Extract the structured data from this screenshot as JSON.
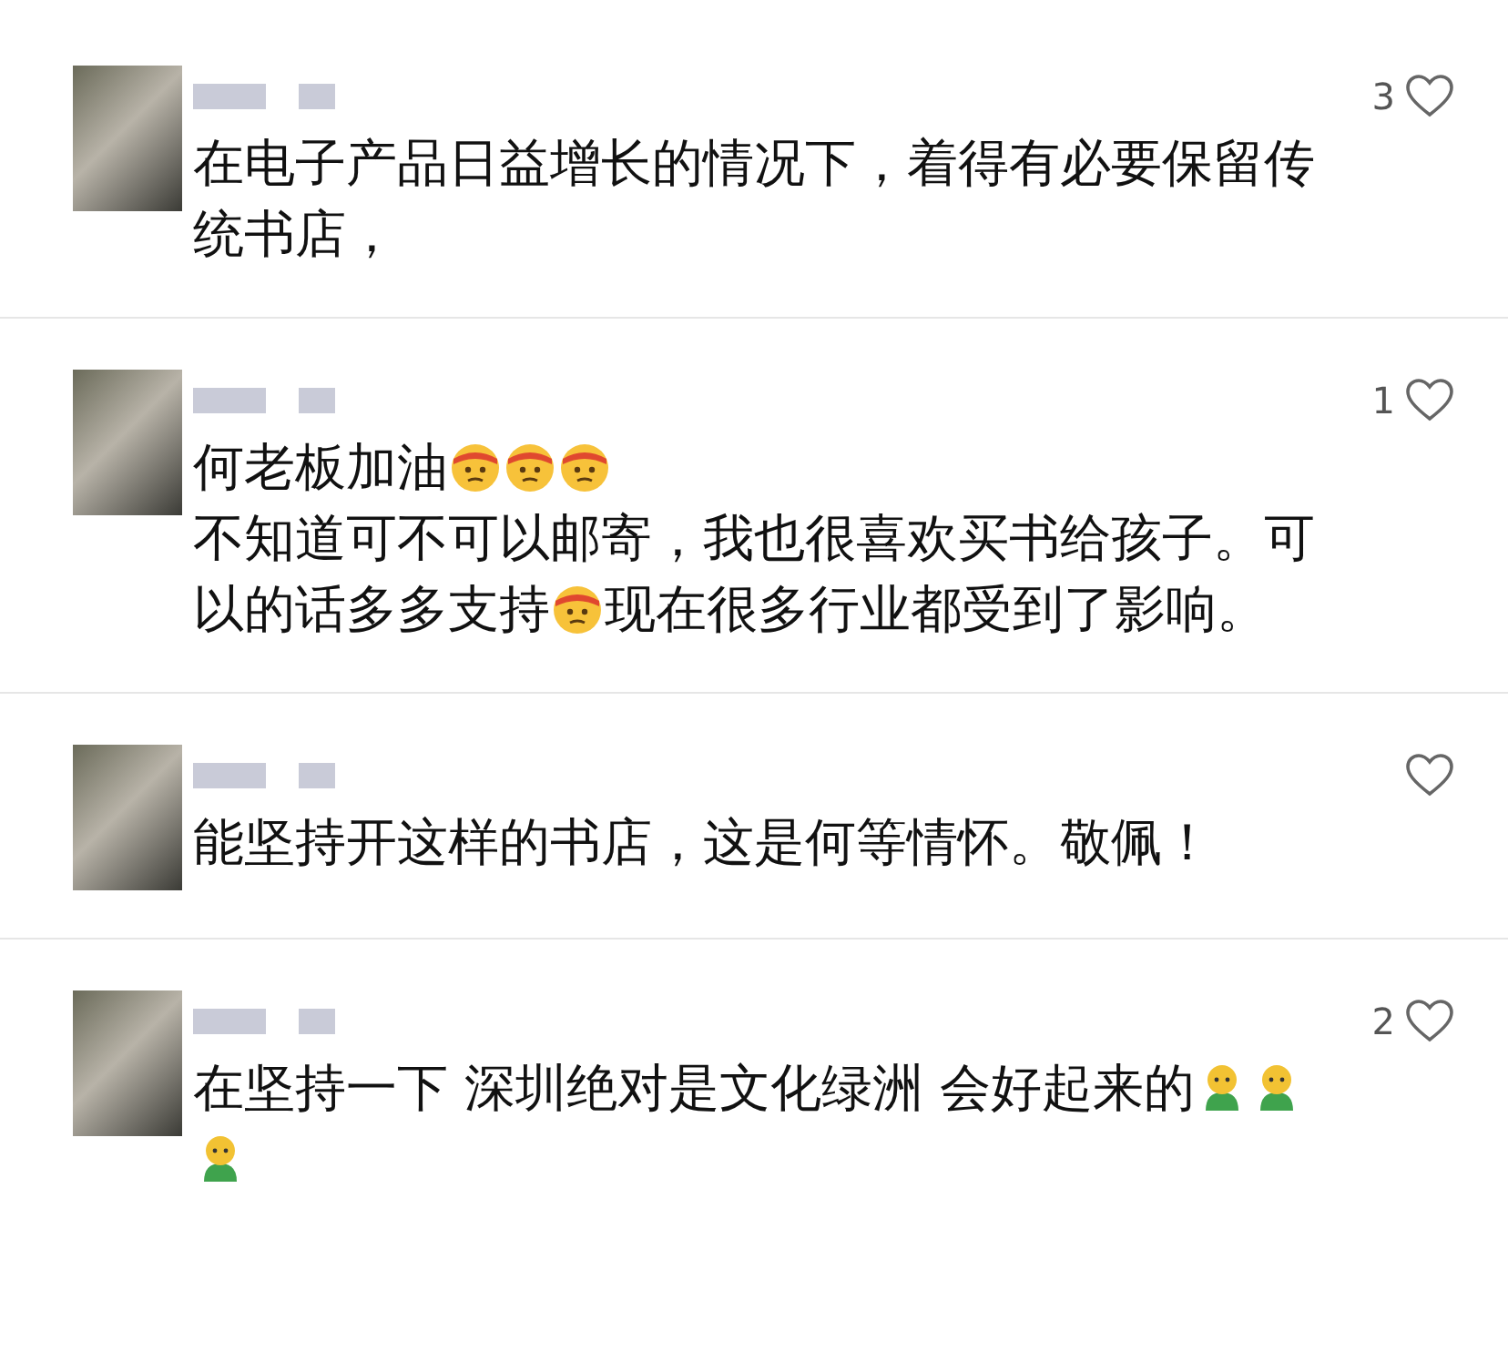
{
  "comments": [
    {
      "likes": "3",
      "liked": false,
      "paragraphs": [
        [
          {
            "kind": "text",
            "text": "在电子产品日益增长的情况下，着得有必要保留传"
          }
        ],
        [
          {
            "kind": "text",
            "text": "统书店，"
          }
        ]
      ]
    },
    {
      "likes": "1",
      "liked": false,
      "paragraphs": [
        [
          {
            "kind": "text",
            "text": "何老板加油"
          },
          {
            "kind": "emoji"
          },
          {
            "kind": "emoji"
          },
          {
            "kind": "emoji"
          }
        ],
        [
          {
            "kind": "text",
            "text": "不知道可不可以邮寄，我也很喜欢买书给孩子。可"
          }
        ],
        [
          {
            "kind": "text",
            "text": "以的话多多支持"
          },
          {
            "kind": "emoji"
          },
          {
            "kind": "text",
            "text": "现在很多行业都受到了影响。"
          }
        ]
      ]
    },
    {
      "liked": false,
      "paragraphs": [
        [
          {
            "kind": "text",
            "text": "能坚持开这样的书店，这是何等情怀。敬佩！"
          }
        ]
      ]
    },
    {
      "likes": "2",
      "liked": false,
      "paragraphs": [
        [
          {
            "kind": "text",
            "text": "在坚持一下 深圳绝对是文化绿洲 会好起来的"
          },
          {
            "kind": "person"
          },
          {
            "kind": "person"
          }
        ],
        [
          {
            "kind": "person"
          }
        ]
      ]
    }
  ]
}
